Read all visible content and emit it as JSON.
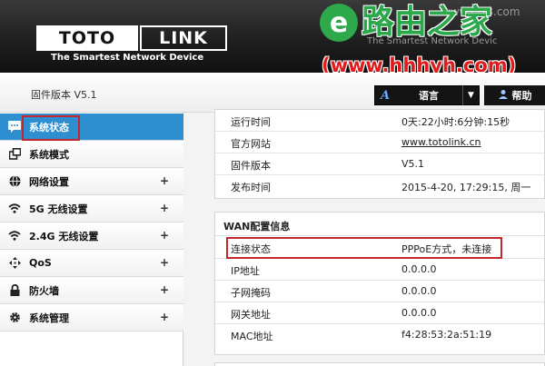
{
  "header": {
    "logo_part1": "TOTO",
    "logo_part2": "LINK",
    "tagline": "The Smartest Network Device",
    "ghost_url": "www.i5z8.com",
    "ghost_slogan": "The Smartest Network Devic"
  },
  "watermark": {
    "badge": "e",
    "title": "路由之家",
    "url": "(www.hhhyh.com)"
  },
  "subheader": {
    "firmware_label": "固件版本 V5.1",
    "language_icon": "A",
    "language_label": "语言",
    "language_arrow": "▼",
    "help_label": "帮助"
  },
  "sidebar": {
    "items": [
      {
        "label": "系统状态",
        "icon": "chat-bubble-icon",
        "expandable": false,
        "active": true
      },
      {
        "label": "系统模式",
        "icon": "windows-icon",
        "expandable": false,
        "active": false
      },
      {
        "label": "网络设置",
        "icon": "globe-icon",
        "expandable": true,
        "active": false
      },
      {
        "label": "5G 无线设置",
        "icon": "wifi-icon",
        "expandable": true,
        "active": false
      },
      {
        "label": "2.4G 无线设置",
        "icon": "wifi-icon",
        "expandable": true,
        "active": false
      },
      {
        "label": "QoS",
        "icon": "qos-arrows-icon",
        "expandable": true,
        "active": false
      },
      {
        "label": "防火墙",
        "icon": "lock-icon",
        "expandable": true,
        "active": false
      },
      {
        "label": "系统管理",
        "icon": "gear-icon",
        "expandable": true,
        "active": false
      }
    ],
    "plus_symbol": "+"
  },
  "system_info": {
    "rows": [
      {
        "key": "运行时间",
        "value": "0天:22小时:6分钟:15秒"
      },
      {
        "key": "官方网站",
        "value": "www.totolink.cn"
      },
      {
        "key": "固件版本",
        "value": "V5.1"
      },
      {
        "key": "发布时间",
        "value": "2015-4-20, 17:29:15, 周一"
      }
    ]
  },
  "wan_info": {
    "title": "WAN配置信息",
    "rows": [
      {
        "key": "连接状态",
        "value": "PPPoE方式，未连接"
      },
      {
        "key": "IP地址",
        "value": "0.0.0.0"
      },
      {
        "key": "子网掩码",
        "value": "0.0.0.0"
      },
      {
        "key": "网关地址",
        "value": "0.0.0.0"
      },
      {
        "key": "MAC地址",
        "value": "f4:28:53:2a:51:19"
      }
    ]
  },
  "colors": {
    "active_blue": "#2d8fd0",
    "highlight_red": "#c2272d",
    "watermark_green": "#2aa84a",
    "watermark_red": "#e01b1b"
  }
}
